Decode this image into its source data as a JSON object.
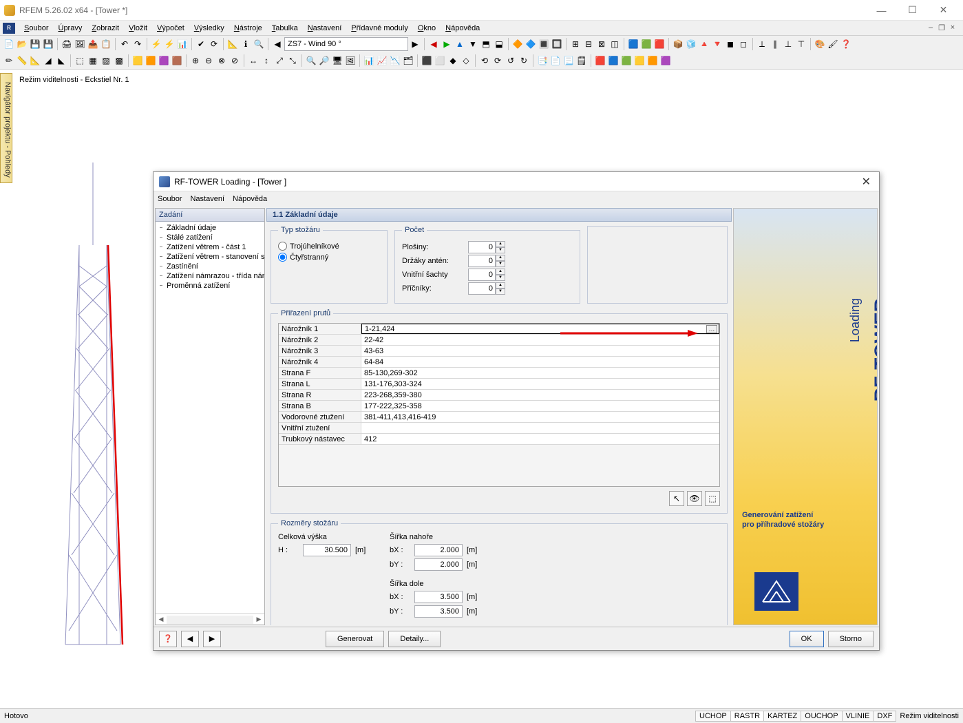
{
  "app": {
    "title": "RFEM 5.26.02 x64 - [Tower *]"
  },
  "menu": [
    "Soubor",
    "Úpravy",
    "Zobrazit",
    "Vložit",
    "Výpočet",
    "Výsledky",
    "Nástroje",
    "Tabulka",
    "Nastavení",
    "Přídavné moduly",
    "Okno",
    "Nápověda"
  ],
  "toolbar_combo": "ZS7 - Wind 90 °",
  "vismode": "Režim viditelnosti - Eckstiel Nr. 1",
  "nav_tab": "Navigátor projektu - Pohledy",
  "dialog": {
    "title": "RF-TOWER Loading - [Tower ]",
    "menu": [
      "Soubor",
      "Nastavení",
      "Nápověda"
    ],
    "tree_head": "Zadání",
    "tree": [
      "Základní údaje",
      "Stálé zatížení",
      "Zatížení větrem - část 1",
      "Zatížení větrem - stanovení součinitelů",
      "Zastínění",
      "Zatížení námrazou - třída námrazy",
      "Proměnná zatížení"
    ],
    "main_head": "1.1 Základní údaje",
    "type_legend": "Typ stožáru",
    "type_radio1": "Trojúhelníkové",
    "type_radio2": "Čtyřstranný",
    "count_legend": "Počet",
    "counts": [
      {
        "label": "Plošiny:",
        "value": "0"
      },
      {
        "label": "Držáky antén:",
        "value": "0"
      },
      {
        "label": "Vnitřní šachty",
        "value": "0"
      },
      {
        "label": "Příčníky:",
        "value": "0"
      }
    ],
    "assign_legend": "Přiřazení prutů",
    "assign_rows": [
      {
        "k": "Nárožník 1",
        "v": "1-21,424",
        "sel": true
      },
      {
        "k": "Nárožník 2",
        "v": "22-42"
      },
      {
        "k": "Nárožník 3",
        "v": "43-63"
      },
      {
        "k": "Nárožník 4",
        "v": "64-84"
      },
      {
        "k": "Strana F",
        "v": "85-130,269-302"
      },
      {
        "k": "Strana L",
        "v": "131-176,303-324"
      },
      {
        "k": "Strana R",
        "v": "223-268,359-380"
      },
      {
        "k": "Strana B",
        "v": "177-222,325-358"
      },
      {
        "k": "Vodorovné ztužení",
        "v": "381-411,413,416-419"
      },
      {
        "k": "Vnitřní ztužení",
        "v": ""
      },
      {
        "k": "Trubkový nástavec",
        "v": "412"
      }
    ],
    "dims_legend": "Rozměry stožáru",
    "dim_h_head": "Celková výška",
    "dim_h_label": "H :",
    "dim_h_value": "30.500",
    "dim_h_unit": "[m]",
    "dim_top_head": "Šířka nahoře",
    "dim_bx_label": "bX :",
    "dim_bx_top": "2.000",
    "dim_by_label": "bY :",
    "dim_by_top": "2.000",
    "dim_bot_head": "Šířka dole",
    "dim_bx_bot": "3.500",
    "dim_by_bot": "3.500",
    "dim_unit": "[m]",
    "promo_brand": "RF-TOWER",
    "promo_sub": "Loading",
    "promo_tag1": "Generování zatížení",
    "promo_tag2": "pro příhradové stožáry",
    "btn_gen": "Generovat",
    "btn_det": "Detaily...",
    "btn_ok": "OK",
    "btn_cancel": "Storno"
  },
  "status": {
    "left": "Hotovo",
    "segs": [
      "UCHOP",
      "RASTR",
      "KARTEZ",
      "OUCHOP",
      "VLINIE",
      "DXF"
    ],
    "right": "Režim viditelnosti"
  }
}
